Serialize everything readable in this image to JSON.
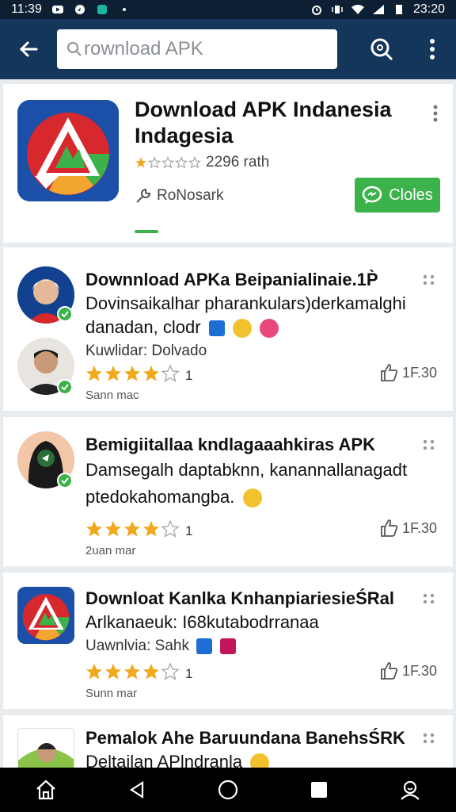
{
  "status_bar": {
    "time": "11:39",
    "clock_right": "23:20"
  },
  "toolbar": {
    "search_value": "rownload APK"
  },
  "hero": {
    "title": "Download APK Indanesia Indagesia",
    "rating_text": "2296 rath",
    "developer": "RoNosark",
    "open_label": "Cloles"
  },
  "cards": [
    {
      "title": "Downnload APKa Beipanialinaie.1P̀",
      "line1": "Dovinsaikalhar pharankulars)derkamalghi",
      "line2": "danadan, clodr",
      "meta": "Kuwlidar: Dolvado",
      "rating_count": "1",
      "likes": "1F.30",
      "time": "Sann mac"
    },
    {
      "title": "Bemigiitallaa kndlagaaahkiras APK",
      "line1": "Damsegalh daptabknn, kanannallanagadt",
      "line2": "ptedokahomangba.",
      "rating_count": "1",
      "likes": "1F.30",
      "time": "2uan mar"
    },
    {
      "title": "Downloat Kanlka KnhanpiariesieŚRal",
      "line1": "Arlkanaeuk: I68kutabodrranaa",
      "meta": "Uawnlvia: Sahk",
      "rating_count": "1",
      "likes": "1F.30",
      "time": "Sunn mar"
    },
    {
      "title": "Pemalok Ahe Baruundana BanehsŚRK",
      "line1": "Deltailan APlndranla"
    }
  ],
  "colors": {
    "toolbar": "#13365a",
    "accent_green": "#3bb34a",
    "star": "#f0a81c"
  },
  "icons": [
    "back-arrow-icon",
    "search-icon",
    "more-vert-icon",
    "share-icon",
    "chat-icon",
    "thumbs-up-icon",
    "home-icon",
    "back-nav-icon",
    "circle-home-icon",
    "square-recents-icon",
    "account-icon"
  ]
}
